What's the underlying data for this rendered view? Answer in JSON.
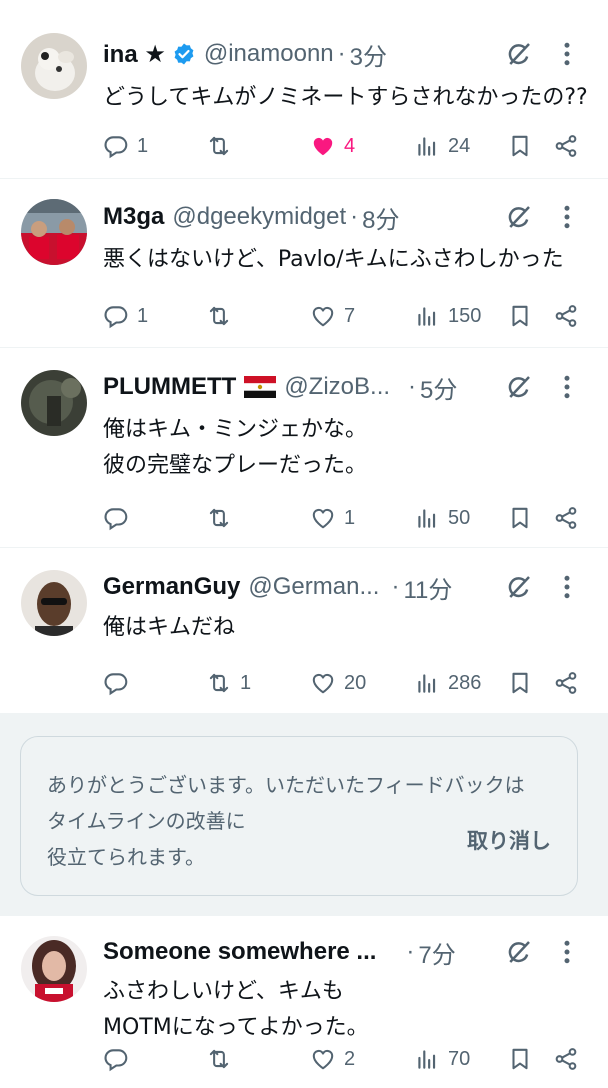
{
  "tweets": [
    {
      "name": "ina ★",
      "handle": "@inamoonn",
      "dot": "·",
      "time": "3分",
      "lines": [
        "どうしてキムがノミネートすらされなかったの??"
      ],
      "replies": "1",
      "retweets": "",
      "likes": "4",
      "views": "24"
    },
    {
      "name": "M3ga",
      "handle": "@dgeekymidget",
      "dot": "·",
      "time": "8分",
      "lines": [
        "悪くはないけど、Pavlo/キムにふさわしかった"
      ],
      "replies": "1",
      "retweets": "",
      "likes": "7",
      "views": "150"
    },
    {
      "name": "PLUMMETT",
      "handle": "@ZizoB...",
      "dot": "·",
      "time": "5分",
      "lines": [
        "俺はキム・ミンジェかな。",
        "彼の完璧なプレーだった。"
      ],
      "replies": "",
      "retweets": "",
      "likes": "1",
      "views": "50"
    },
    {
      "name": "GermanGuy",
      "handle": "@German...",
      "dot": "·",
      "time": "11分",
      "lines": [
        "俺はキムだね"
      ],
      "replies": "",
      "retweets": "1",
      "likes": "20",
      "views": "286"
    },
    {
      "name": "Someone somewhere ...",
      "handle": "",
      "dot": "·",
      "time": "7分",
      "lines": [
        "ふさわしいけど、キムも",
        "MOTMになってよかった。"
      ],
      "replies": "",
      "retweets": "",
      "likes": "2",
      "views": "70"
    }
  ],
  "feedback": {
    "lines": [
      "ありがとうございます。いただいたフィードバックは",
      "タイムラインの改善に",
      "役立てられます。"
    ],
    "undo_label": "取り消し"
  },
  "icons": {
    "verified": "verified-badge-icon",
    "flag": "egypt-flag-icon",
    "grok": "grok-icon",
    "more": "more-vertical-icon",
    "reply": "reply-icon",
    "retweet": "retweet-icon",
    "like": "heart-icon",
    "views": "views-icon",
    "bookmark": "bookmark-icon",
    "share": "share-icon"
  },
  "colors": {
    "text": "#0f1419",
    "secondary": "#536471",
    "like_active": "#f91880",
    "verified": "#1d9bf0",
    "divider": "#eff3f4",
    "feedback_bg": "#eff3f4"
  }
}
